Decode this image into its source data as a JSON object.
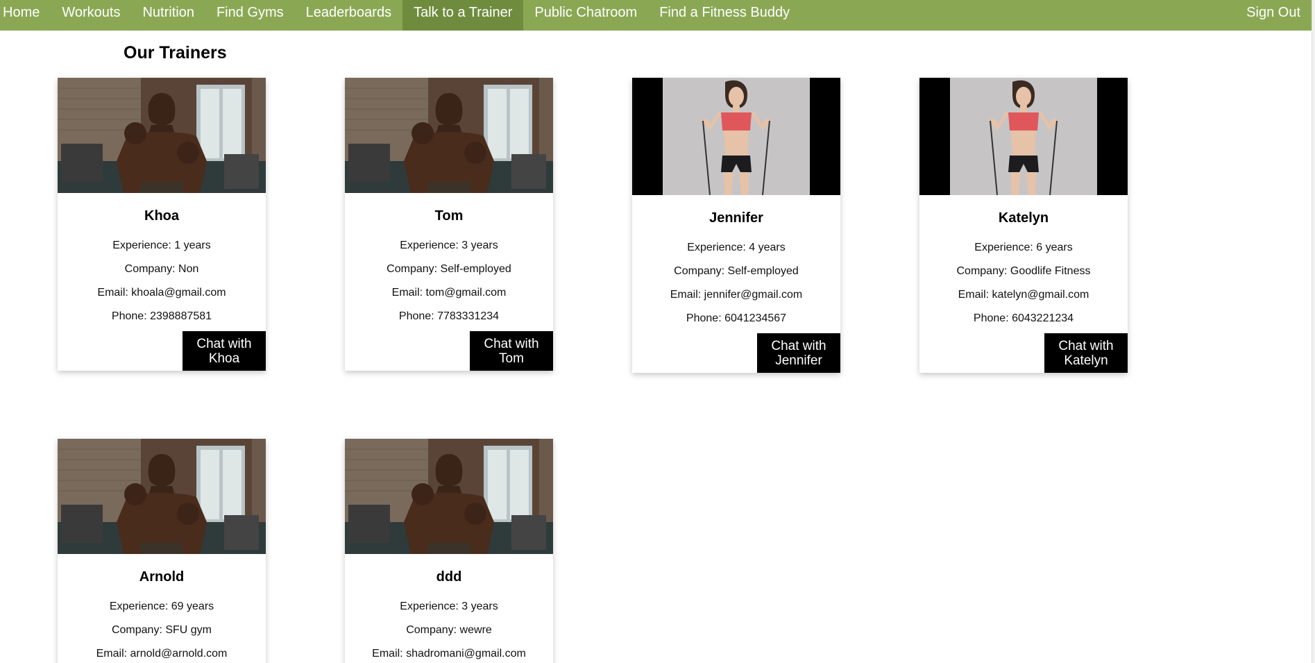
{
  "nav": {
    "items": [
      "Home",
      "Workouts",
      "Nutrition",
      "Find Gyms",
      "Leaderboards",
      "Talk to a Trainer",
      "Public Chatroom",
      "Find a Fitness Buddy"
    ],
    "active_index": 5,
    "sign_out": "Sign Out"
  },
  "page_title": "Our Trainers",
  "trainers": [
    {
      "name": "Khoa",
      "experience": "Experience: 1 years",
      "company": "Company: Non",
      "email": "Email: khoala@gmail.com",
      "phone": "Phone: 2398887581",
      "chat_line1": "Chat with",
      "chat_line2": "Khoa",
      "photo": "male-boxer-photo"
    },
    {
      "name": "Tom",
      "experience": "Experience: 3 years",
      "company": "Company: Self-employed",
      "email": "Email: tom@gmail.com",
      "phone": "Phone: 7783331234",
      "chat_line1": "Chat with",
      "chat_line2": "Tom",
      "photo": "male-boxer-photo"
    },
    {
      "name": "Jennifer",
      "experience": "Experience: 4 years",
      "company": "Company: Self-employed",
      "email": "Email: jennifer@gmail.com",
      "phone": "Phone: 6041234567",
      "chat_line1": "Chat with",
      "chat_line2": "Jennifer",
      "photo": "female-fitness-photo"
    },
    {
      "name": "Katelyn",
      "experience": "Experience: 6 years",
      "company": "Company: Goodlife Fitness",
      "email": "Email: katelyn@gmail.com",
      "phone": "Phone: 6043221234",
      "chat_line1": "Chat with",
      "chat_line2": "Katelyn",
      "photo": "female-fitness-photo"
    },
    {
      "name": "Arnold",
      "experience": "Experience: 69 years",
      "company": "Company: SFU gym",
      "email": "Email: arnold@arnold.com",
      "phone": "",
      "chat_line1": "",
      "chat_line2": "",
      "photo": "male-boxer-photo"
    },
    {
      "name": "ddd",
      "experience": "Experience: 3 years",
      "company": "Company: wewre",
      "email": "Email: shadromani@gmail.com",
      "phone": "",
      "chat_line1": "",
      "chat_line2": "",
      "photo": "male-boxer-photo"
    }
  ]
}
